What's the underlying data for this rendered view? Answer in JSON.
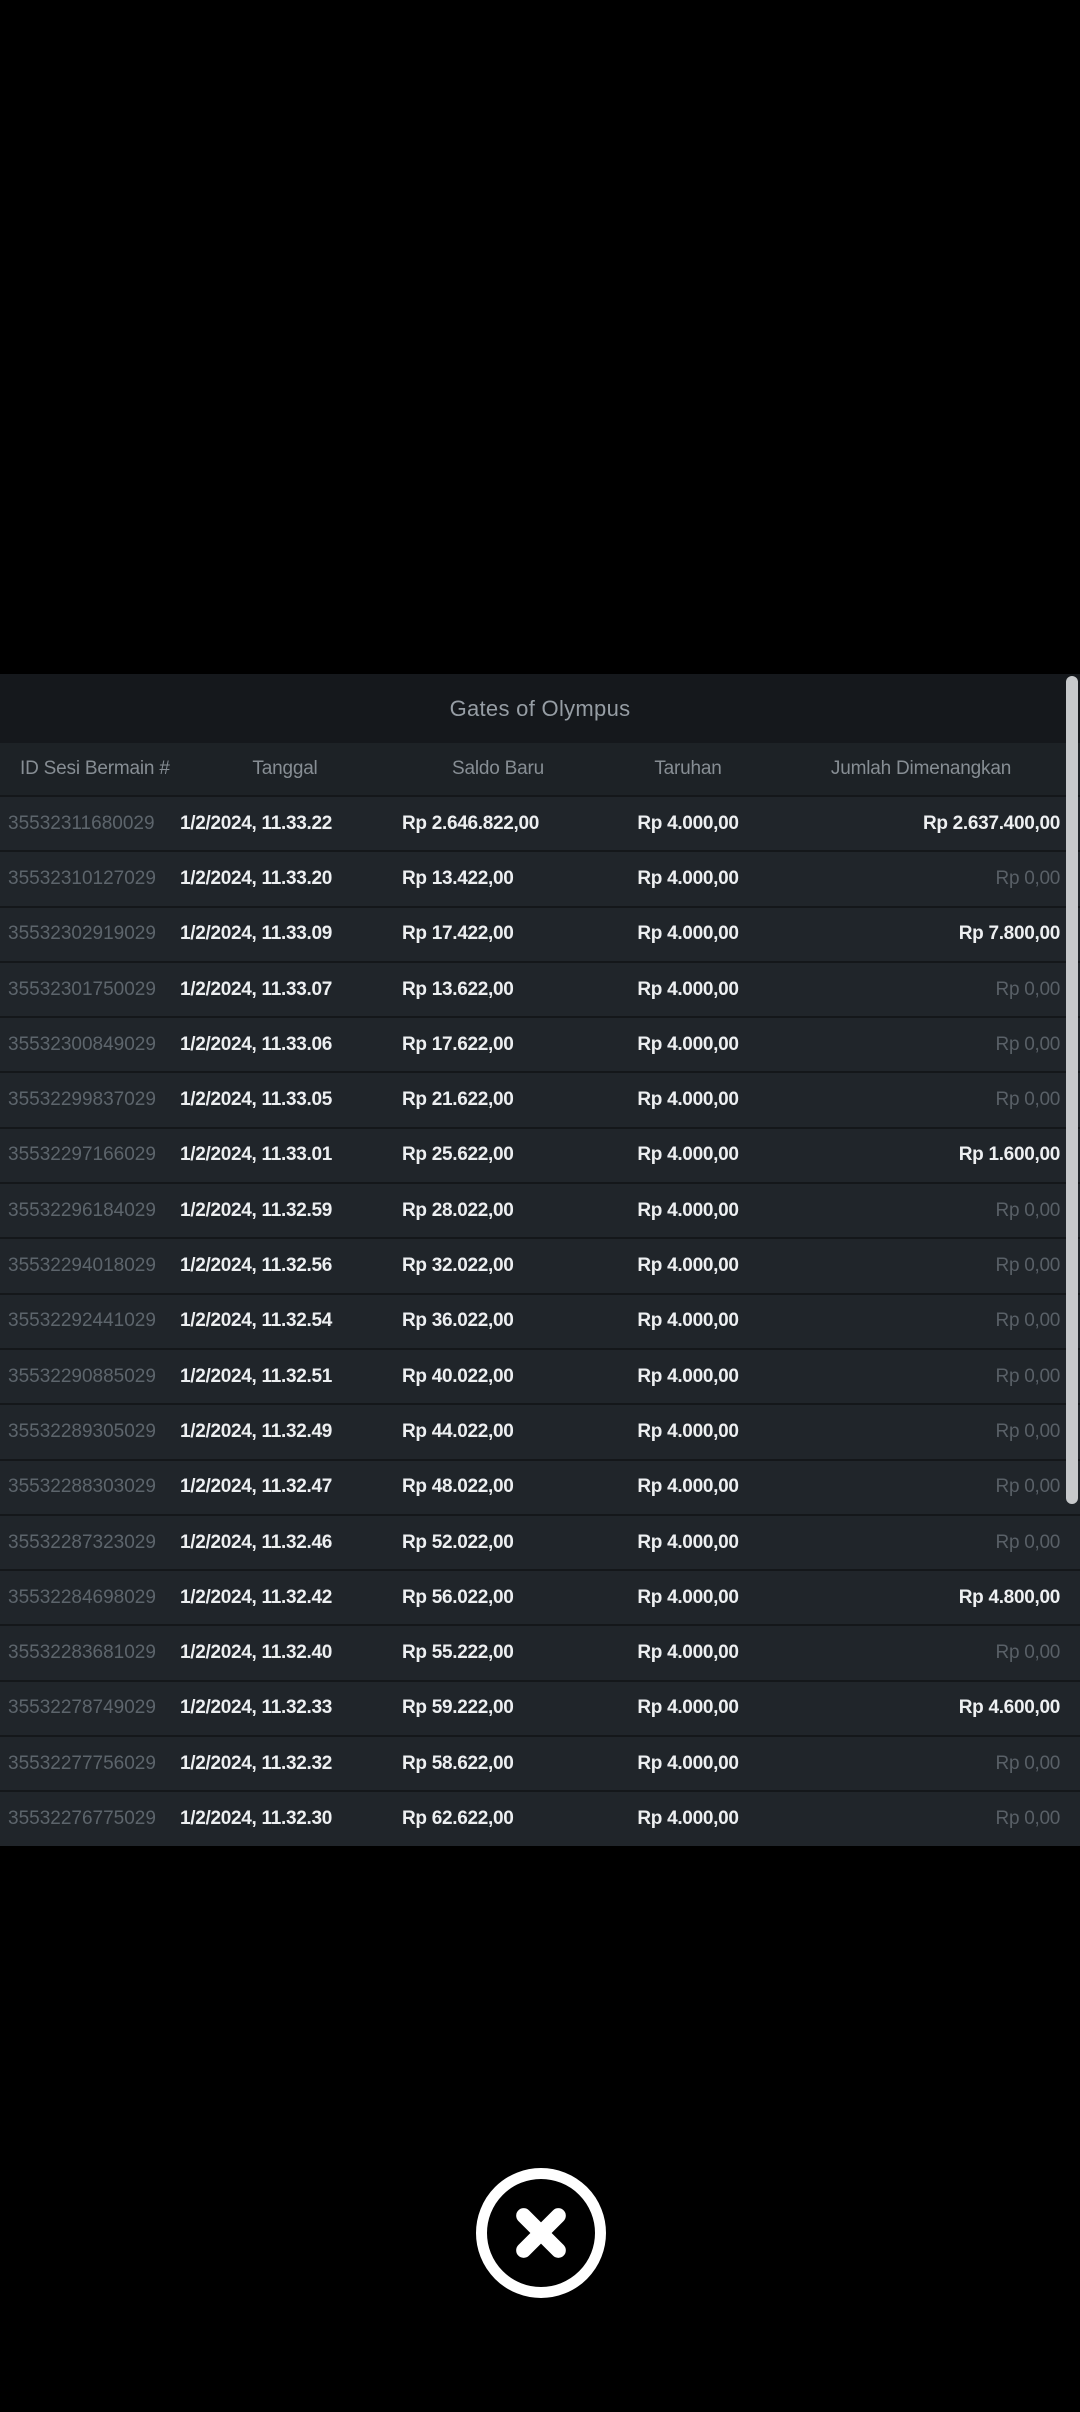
{
  "modal": {
    "title": "Gates of Olympus",
    "columns": [
      "ID Sesi Bermain #",
      "Tanggal",
      "Saldo Baru",
      "Taruhan",
      "Jumlah Dimenangkan"
    ],
    "zero_amount": "Rp 0,00",
    "rows": [
      {
        "id": "35532311680029",
        "date": "1/2/2024, 11.33.22",
        "saldo": "Rp 2.646.822,00",
        "taruhan": "Rp 4.000,00",
        "jumlah": "Rp 2.637.400,00"
      },
      {
        "id": "35532310127029",
        "date": "1/2/2024, 11.33.20",
        "saldo": "Rp 13.422,00",
        "taruhan": "Rp 4.000,00",
        "jumlah": "Rp 0,00"
      },
      {
        "id": "35532302919029",
        "date": "1/2/2024, 11.33.09",
        "saldo": "Rp 17.422,00",
        "taruhan": "Rp 4.000,00",
        "jumlah": "Rp 7.800,00"
      },
      {
        "id": "35532301750029",
        "date": "1/2/2024, 11.33.07",
        "saldo": "Rp 13.622,00",
        "taruhan": "Rp 4.000,00",
        "jumlah": "Rp 0,00"
      },
      {
        "id": "35532300849029",
        "date": "1/2/2024, 11.33.06",
        "saldo": "Rp 17.622,00",
        "taruhan": "Rp 4.000,00",
        "jumlah": "Rp 0,00"
      },
      {
        "id": "35532299837029",
        "date": "1/2/2024, 11.33.05",
        "saldo": "Rp 21.622,00",
        "taruhan": "Rp 4.000,00",
        "jumlah": "Rp 0,00"
      },
      {
        "id": "35532297166029",
        "date": "1/2/2024, 11.33.01",
        "saldo": "Rp 25.622,00",
        "taruhan": "Rp 4.000,00",
        "jumlah": "Rp 1.600,00"
      },
      {
        "id": "35532296184029",
        "date": "1/2/2024, 11.32.59",
        "saldo": "Rp 28.022,00",
        "taruhan": "Rp 4.000,00",
        "jumlah": "Rp 0,00"
      },
      {
        "id": "35532294018029",
        "date": "1/2/2024, 11.32.56",
        "saldo": "Rp 32.022,00",
        "taruhan": "Rp 4.000,00",
        "jumlah": "Rp 0,00"
      },
      {
        "id": "35532292441029",
        "date": "1/2/2024, 11.32.54",
        "saldo": "Rp 36.022,00",
        "taruhan": "Rp 4.000,00",
        "jumlah": "Rp 0,00"
      },
      {
        "id": "35532290885029",
        "date": "1/2/2024, 11.32.51",
        "saldo": "Rp 40.022,00",
        "taruhan": "Rp 4.000,00",
        "jumlah": "Rp 0,00"
      },
      {
        "id": "35532289305029",
        "date": "1/2/2024, 11.32.49",
        "saldo": "Rp 44.022,00",
        "taruhan": "Rp 4.000,00",
        "jumlah": "Rp 0,00"
      },
      {
        "id": "35532288303029",
        "date": "1/2/2024, 11.32.47",
        "saldo": "Rp 48.022,00",
        "taruhan": "Rp 4.000,00",
        "jumlah": "Rp 0,00"
      },
      {
        "id": "35532287323029",
        "date": "1/2/2024, 11.32.46",
        "saldo": "Rp 52.022,00",
        "taruhan": "Rp 4.000,00",
        "jumlah": "Rp 0,00"
      },
      {
        "id": "35532284698029",
        "date": "1/2/2024, 11.32.42",
        "saldo": "Rp 56.022,00",
        "taruhan": "Rp 4.000,00",
        "jumlah": "Rp 4.800,00"
      },
      {
        "id": "35532283681029",
        "date": "1/2/2024, 11.32.40",
        "saldo": "Rp 55.222,00",
        "taruhan": "Rp 4.000,00",
        "jumlah": "Rp 0,00"
      },
      {
        "id": "35532278749029",
        "date": "1/2/2024, 11.32.33",
        "saldo": "Rp 59.222,00",
        "taruhan": "Rp 4.000,00",
        "jumlah": "Rp 4.600,00"
      },
      {
        "id": "35532277756029",
        "date": "1/2/2024, 11.32.32",
        "saldo": "Rp 58.622,00",
        "taruhan": "Rp 4.000,00",
        "jumlah": "Rp 0,00"
      },
      {
        "id": "35532276775029",
        "date": "1/2/2024, 11.32.30",
        "saldo": "Rp 62.622,00",
        "taruhan": "Rp 4.000,00",
        "jumlah": "Rp 0,00"
      }
    ]
  },
  "colors": {
    "page_background": "#000000",
    "modal_background": "#20252a",
    "titlebar_background": "#15181c",
    "header_background": "#1d2226",
    "row_separator": "#14171a",
    "text_primary": "#edeff1",
    "text_muted": "#5d656c",
    "text_zero_amount": "#596067",
    "scrollbar_thumb": "#c7c9cb",
    "close_button": "#ffffff"
  }
}
